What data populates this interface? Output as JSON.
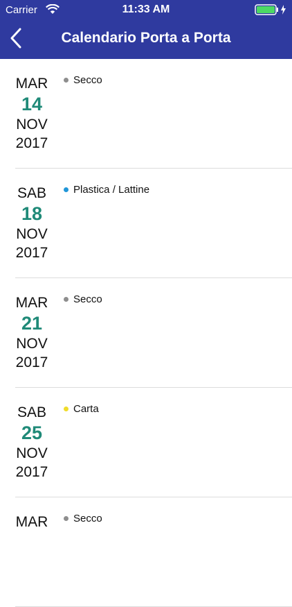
{
  "status_bar": {
    "carrier": "Carrier",
    "time": "11:33 AM"
  },
  "nav": {
    "title": "Calendario Porta a Porta"
  },
  "entries": [
    {
      "dow": "MAR",
      "day": "14",
      "month": "NOV",
      "year": "2017",
      "event": "Secco",
      "color": "#8e8e8e"
    },
    {
      "dow": "SAB",
      "day": "18",
      "month": "NOV",
      "year": "2017",
      "event": "Plastica / Lattine",
      "color": "#2196d8"
    },
    {
      "dow": "MAR",
      "day": "21",
      "month": "NOV",
      "year": "2017",
      "event": "Secco",
      "color": "#8e8e8e"
    },
    {
      "dow": "SAB",
      "day": "25",
      "month": "NOV",
      "year": "2017",
      "event": "Carta",
      "color": "#f0dc2a"
    },
    {
      "dow": "MAR",
      "day": "",
      "month": "",
      "year": "",
      "event": "Secco",
      "color": "#8e8e8e"
    }
  ],
  "colors": {
    "header": "#2f3a9f",
    "day_number": "#1f8a78"
  }
}
